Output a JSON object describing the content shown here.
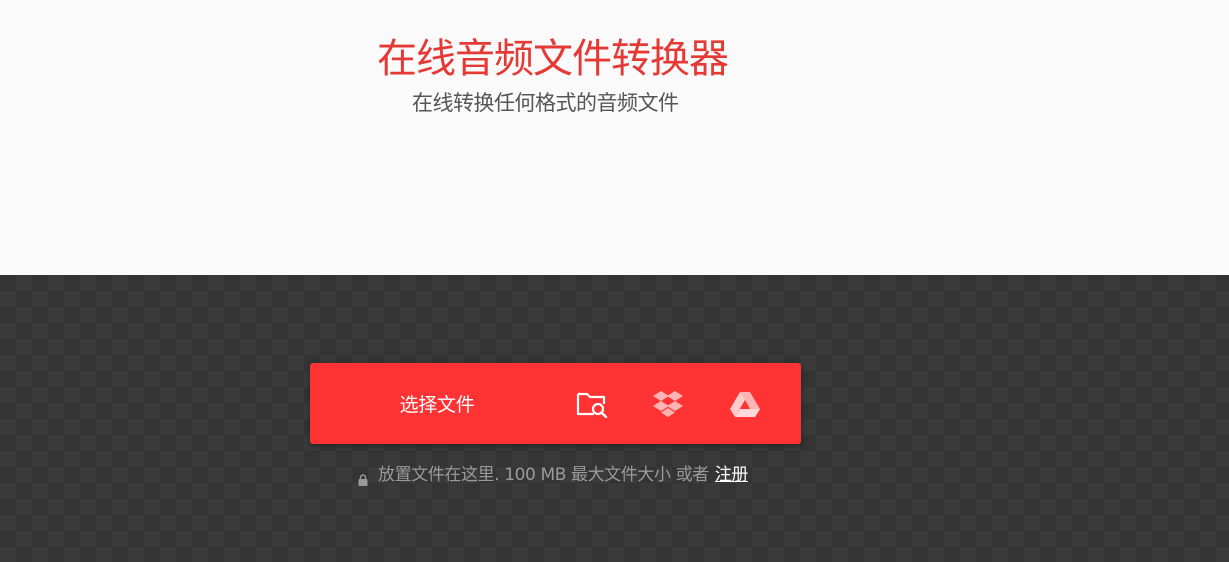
{
  "hero": {
    "title": "在线音频文件转换器",
    "subtitle": "在线转换任何格式的音频文件"
  },
  "upload": {
    "choose_label": "选择文件",
    "sources": [
      {
        "icon": "folder-search-icon",
        "action": "device"
      },
      {
        "icon": "dropbox-icon",
        "action": "dropbox"
      },
      {
        "icon": "google-drive-icon",
        "action": "google-drive"
      }
    ],
    "note_text": "放置文件在这里. 100 MB 最大文件大小 或者",
    "signup_label": "注册",
    "lock_icon": "lock-icon"
  },
  "colors": {
    "accent": "#ff3333",
    "title": "#e53935",
    "dark_bg": "#343434"
  }
}
